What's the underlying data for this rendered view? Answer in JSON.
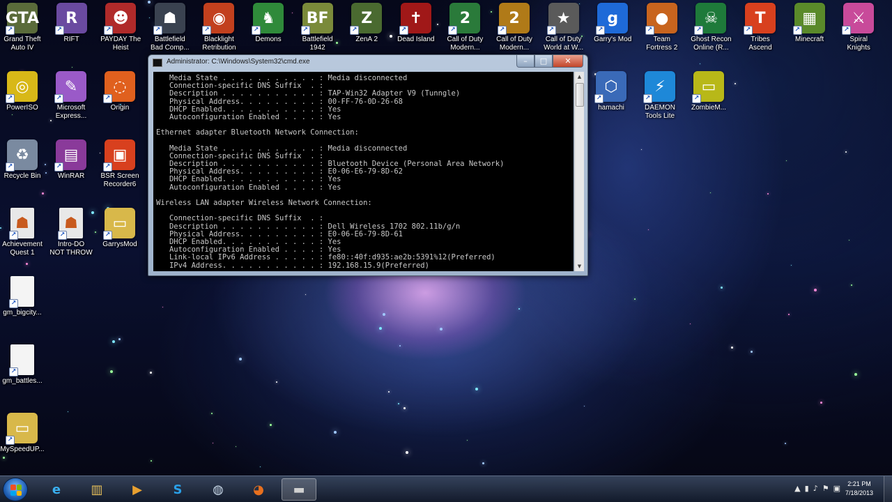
{
  "desktop_icons": [
    {
      "label": "Grand Theft\nAuto IV",
      "icon": "gta-icon",
      "glyph": "GTA",
      "color": "#5a6b3a"
    },
    {
      "label": "RIFT",
      "icon": "rift-icon",
      "glyph": "R",
      "color": "#6a4aa0"
    },
    {
      "label": "PAYDAY The\nHeist",
      "icon": "payday-icon",
      "glyph": "☻",
      "color": "#b02a2a"
    },
    {
      "label": "Battlefield\nBad Comp...",
      "icon": "battlefield-icon",
      "glyph": "☗",
      "color": "#3a4250"
    },
    {
      "label": "Blacklight\nRetribution",
      "icon": "blacklight-icon",
      "glyph": "◉",
      "color": "#c2401e"
    },
    {
      "label": "Demons",
      "icon": "demons-icon",
      "glyph": "♞",
      "color": "#2f8a3a"
    },
    {
      "label": "Battlefield\n1942",
      "icon": "battlefield-1942-icon",
      "glyph": "BF",
      "color": "#7a8a3a"
    },
    {
      "label": "ZenA 2",
      "icon": "zena-icon",
      "glyph": "Z",
      "color": "#4a6a30"
    },
    {
      "label": "Dead Island",
      "icon": "dead-island-icon",
      "glyph": "✝",
      "color": "#a01818"
    },
    {
      "label": "Call of Duty\nModern...",
      "icon": "cod-mw2-icon",
      "glyph": "2",
      "color": "#2a7a3a"
    },
    {
      "label": "Call of Duty\nModern...",
      "icon": "cod-mw2-alt-icon",
      "glyph": "2",
      "color": "#b07a18"
    },
    {
      "label": "Call of Duty\nWorld at W...",
      "icon": "cod-waw-icon",
      "glyph": "★",
      "color": "#5a5a5a"
    },
    {
      "label": "Garry's Mod",
      "icon": "garrys-mod-icon",
      "glyph": "g",
      "color": "#1e6ad8"
    },
    {
      "label": "Team\nFortress 2",
      "icon": "tf2-icon",
      "glyph": "●",
      "color": "#c8641e"
    },
    {
      "label": "Ghost Recon\nOnline (R...",
      "icon": "ghost-recon-icon",
      "glyph": "☠",
      "color": "#1e7a3a"
    },
    {
      "label": "Tribes\nAscend",
      "icon": "tribes-icon",
      "glyph": "T",
      "color": "#d8401e"
    },
    {
      "label": "Minecraft",
      "icon": "minecraft-icon",
      "glyph": "▦",
      "color": "#5a8a2a"
    },
    {
      "label": "Spiral\nKnights",
      "icon": "spiral-knights-icon",
      "glyph": "⚔",
      "color": "#c84a9a"
    },
    {
      "label": "PowerISO",
      "icon": "poweriso-icon",
      "glyph": "◎",
      "color": "#d8b818"
    },
    {
      "label": "Microsoft\nExpress...",
      "icon": "ms-expression-icon",
      "glyph": "✎",
      "color": "#9a5ac8"
    },
    {
      "label": "Origin",
      "icon": "origin-icon",
      "glyph": "◌",
      "color": "#e0601e"
    },
    {
      "label": "Recycle Bin",
      "icon": "recycle-bin-icon",
      "glyph": "♻",
      "color": "#7a8aa0"
    },
    {
      "label": "WinRAR",
      "icon": "winrar-icon",
      "glyph": "▤",
      "color": "#8a3a9a"
    },
    {
      "label": "BSR Screen\nRecorder6",
      "icon": "bsr-recorder-icon",
      "glyph": "▣",
      "color": "#d8401e"
    },
    {
      "label": "Achievement\nQuest 1",
      "icon": "achievement-icon",
      "glyph": "☗",
      "color": "#e8e8e8"
    },
    {
      "label": "Intro-DO\nNOT THROW",
      "icon": "intro-file-icon",
      "glyph": "☗",
      "color": "#e8e8e8"
    },
    {
      "label": "GarrysMod",
      "icon": "folder-icon",
      "glyph": "▭",
      "color": "#d8b84a"
    },
    {
      "label": "gm_bigcity...",
      "icon": "file-icon",
      "glyph": "",
      "color": "#f4f4f4"
    },
    {
      "label": "gm_battles...",
      "icon": "file-icon-2",
      "glyph": "",
      "color": "#f4f4f4"
    },
    {
      "label": "MySpeedUP...",
      "icon": "myspeedup-folder-icon",
      "glyph": "▭",
      "color": "#d8b84a"
    },
    {
      "label": "hamachi",
      "icon": "hamachi-icon",
      "glyph": "⬡",
      "color": "#3a6ab8"
    },
    {
      "label": "DAEMON\nTools Lite",
      "icon": "daemon-tools-icon",
      "glyph": "⚡",
      "color": "#1e88d8"
    },
    {
      "label": "ZombieM...",
      "icon": "zombie-folder-icon",
      "glyph": "▭",
      "color": "#b8b818"
    }
  ],
  "console_window": {
    "title": "Administrator: C:\\Windows\\System32\\cmd.exe",
    "min_glyph": "–",
    "max_glyph": "□",
    "close_glyph": "✕",
    "lines": [
      "   Media State . . . . . . . . . . . : Media disconnected",
      "   Connection-specific DNS Suffix  . :",
      "   Description . . . . . . . . . . . : TAP-Win32 Adapter V9 (Tunngle)",
      "   Physical Address. . . . . . . . . : 00-FF-76-0D-26-68",
      "   DHCP Enabled. . . . . . . . . . . : Yes",
      "   Autoconfiguration Enabled . . . . : Yes",
      "",
      "Ethernet adapter Bluetooth Network Connection:",
      "",
      "   Media State . . . . . . . . . . . : Media disconnected",
      "   Connection-specific DNS Suffix  . :",
      "   Description . . . . . . . . . . . : Bluetooth Device (Personal Area Network)",
      "   Physical Address. . . . . . . . . : E0-06-E6-79-8D-62",
      "   DHCP Enabled. . . . . . . . . . . : Yes",
      "   Autoconfiguration Enabled . . . . : Yes",
      "",
      "Wireless LAN adapter Wireless Network Connection:",
      "",
      "   Connection-specific DNS Suffix  . :",
      "   Description . . . . . . . . . . . : Dell Wireless 1702 802.11b/g/n",
      "   Physical Address. . . . . . . . . : E0-06-E6-79-8D-61",
      "   DHCP Enabled. . . . . . . . . . . : Yes",
      "   Autoconfiguration Enabled . . . . : Yes",
      "   Link-local IPv6 Address . . . . . : fe80::40f:d935:ae2b:5391%12(Preferred)",
      "   IPv4 Address. . . . . . . . . . . : 192.168.15.9(Preferred)"
    ]
  },
  "taskbar": {
    "buttons": [
      {
        "name": "internet-explorer-icon",
        "glyph": "e",
        "color": "#3ab0f0",
        "active": false
      },
      {
        "name": "file-explorer-icon",
        "glyph": "▥",
        "color": "#e8c05a",
        "active": false
      },
      {
        "name": "media-player-icon",
        "glyph": "▶",
        "color": "#e8a030",
        "active": false
      },
      {
        "name": "skype-icon",
        "glyph": "S",
        "color": "#2aa0e8",
        "active": false
      },
      {
        "name": "steam-icon",
        "glyph": "◍",
        "color": "#c8d8e8",
        "active": false
      },
      {
        "name": "firefox-icon",
        "glyph": "◕",
        "color": "#e8701e",
        "active": false
      },
      {
        "name": "cmd-icon",
        "glyph": "▬",
        "color": "#d0d0d0",
        "active": true
      }
    ],
    "tray_icons": [
      "▲",
      "▮",
      "♪",
      "⚑",
      "▣"
    ],
    "clock_time": "2:21 PM",
    "clock_date": "7/18/2013"
  }
}
